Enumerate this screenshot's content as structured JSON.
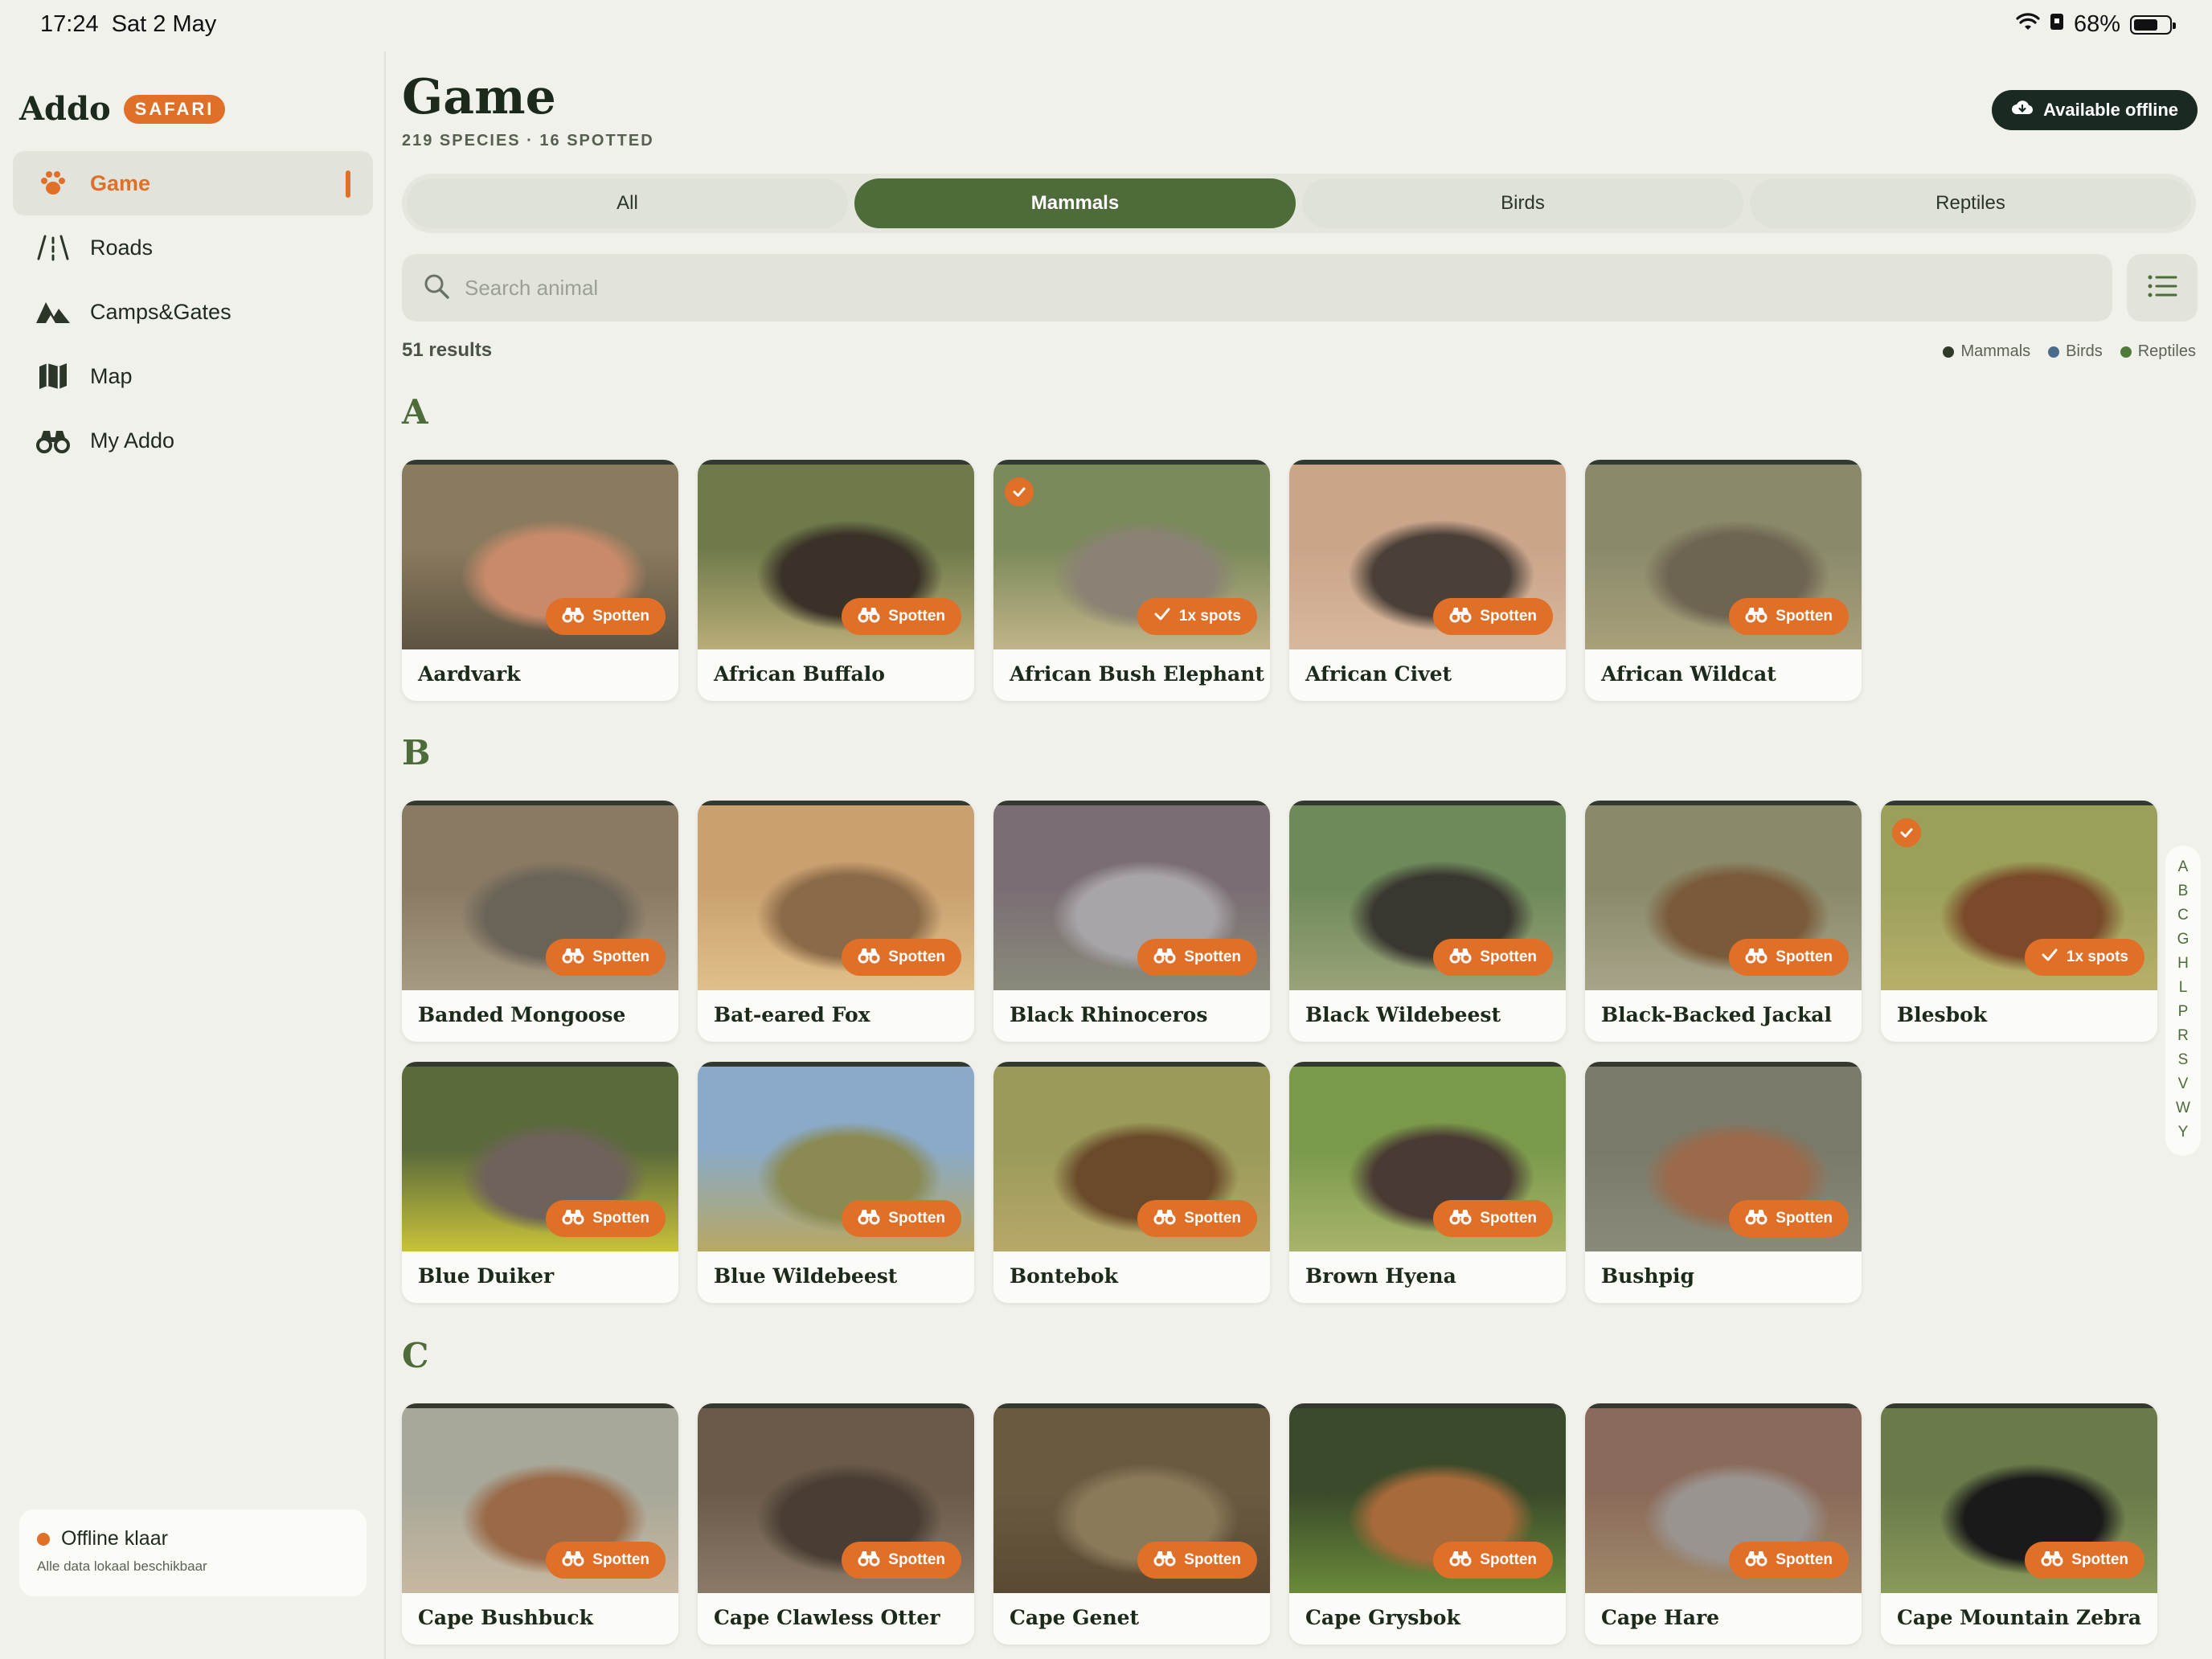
{
  "status": {
    "time": "17:24",
    "date": "Sat 2 May",
    "battery": "68%",
    "battery_level": 0.68
  },
  "sidebar": {
    "brand": "Addo",
    "badge": "SAFARI",
    "items": [
      {
        "label": "Game",
        "icon": "paw-icon",
        "active": true
      },
      {
        "label": "Roads",
        "icon": "road-icon",
        "active": false
      },
      {
        "label": "Camps&Gates",
        "icon": "mountains-icon",
        "active": false
      },
      {
        "label": "Map",
        "icon": "map-icon",
        "active": false
      },
      {
        "label": "My Addo",
        "icon": "binoculars-icon",
        "active": false
      }
    ],
    "offline": {
      "title": "Offline klaar",
      "subtitle": "Alle data lokaal beschikbaar"
    }
  },
  "header": {
    "title": "Game",
    "subtitle": "219 SPECIES · 16 SPOTTED",
    "offline_button": "Available offline"
  },
  "tabs": [
    {
      "label": "All",
      "active": false
    },
    {
      "label": "Mammals",
      "active": true
    },
    {
      "label": "Birds",
      "active": false
    },
    {
      "label": "Reptiles",
      "active": false
    }
  ],
  "search": {
    "placeholder": "Search animal",
    "value": ""
  },
  "results": "51 results",
  "legend": [
    {
      "label": "Mammals",
      "color": "#2f3a2b"
    },
    {
      "label": "Birds",
      "color": "#4b6b8a"
    },
    {
      "label": "Reptiles",
      "color": "#4e7a3a"
    }
  ],
  "sections": [
    {
      "letter": "A",
      "animals": [
        {
          "name": "Aardvark",
          "badge": "Spotten",
          "spotted": false,
          "colors": [
            "#8a7a5e",
            "#c88a6a",
            "#5e5442"
          ]
        },
        {
          "name": "African Buffalo",
          "badge": "Spotten",
          "spotted": false,
          "colors": [
            "#6e7a4a",
            "#3a3228",
            "#b9ad78"
          ]
        },
        {
          "name": "African Bush Elephant",
          "badge": "1x spots",
          "spotted": true,
          "colors": [
            "#7a8a5a",
            "#8a8274",
            "#c2b48a"
          ]
        },
        {
          "name": "African Civet",
          "badge": "Spotten",
          "spotted": false,
          "colors": [
            "#caa58a",
            "#4a4038",
            "#d8b89c"
          ]
        },
        {
          "name": "African Wildcat",
          "badge": "Spotten",
          "spotted": false,
          "colors": [
            "#8a8a6a",
            "#6e6452",
            "#a8a07a"
          ]
        }
      ]
    },
    {
      "letter": "B",
      "animals": [
        {
          "name": "Banded Mongoose",
          "badge": "Spotten",
          "spotted": false,
          "colors": [
            "#8a7a64",
            "#6a6458",
            "#a69a82"
          ]
        },
        {
          "name": "Bat-eared Fox",
          "badge": "Spotten",
          "spotted": false,
          "colors": [
            "#caa070",
            "#8a6a48",
            "#e0c08a"
          ]
        },
        {
          "name": "Black Rhinoceros",
          "badge": "Spotten",
          "spotted": false,
          "colors": [
            "#7a6e74",
            "#a8a4a8",
            "#8a8a7a"
          ]
        },
        {
          "name": "Black Wildebeest",
          "badge": "Spotten",
          "spotted": false,
          "colors": [
            "#6e8a5a",
            "#3a3630",
            "#9aa27a"
          ]
        },
        {
          "name": "Black-Backed Jackal",
          "badge": "Spotten",
          "spotted": false,
          "colors": [
            "#8a8a6a",
            "#7a5a3a",
            "#a8a48a"
          ]
        },
        {
          "name": "Blesbok",
          "badge": "1x spots",
          "spotted": true,
          "colors": [
            "#9aa05a",
            "#7a4a2a",
            "#b8b06a"
          ]
        },
        {
          "name": "Blue Duiker",
          "badge": "Spotten",
          "spotted": false,
          "colors": [
            "#5a6a3a",
            "#6e625a",
            "#c8c23a"
          ]
        },
        {
          "name": "Blue Wildebeest",
          "badge": "Spotten",
          "spotted": false,
          "colors": [
            "#8aaac8",
            "#8a8a52",
            "#b8a862"
          ]
        },
        {
          "name": "Bontebok",
          "badge": "Spotten",
          "spotted": false,
          "colors": [
            "#9a9a5a",
            "#6a4a2a",
            "#b8a86a"
          ]
        },
        {
          "name": "Brown Hyena",
          "badge": "Spotten",
          "spotted": false,
          "colors": [
            "#7a9a4a",
            "#4a3a34",
            "#a8b46a"
          ]
        },
        {
          "name": "Bushpig",
          "badge": "Spotten",
          "spotted": false,
          "colors": [
            "#7a7a6a",
            "#9a6a4a",
            "#8a8a7a"
          ]
        }
      ]
    },
    {
      "letter": "C",
      "animals": [
        {
          "name": "Cape Bushbuck",
          "badge": "Spotten",
          "spotted": false,
          "colors": [
            "#a8a89a",
            "#9a6a48",
            "#c8b8a0"
          ]
        },
        {
          "name": "Cape Clawless Otter",
          "badge": "Spotten",
          "spotted": false,
          "colors": [
            "#6a5a4a",
            "#4a3e34",
            "#8a7a68"
          ]
        },
        {
          "name": "Cape Genet",
          "badge": "Spotten",
          "spotted": false,
          "colors": [
            "#6a5a40",
            "#8a7a5a",
            "#5a4a34"
          ]
        },
        {
          "name": "Cape Grysbok",
          "badge": "Spotten",
          "spotted": false,
          "colors": [
            "#3a4a2a",
            "#a86a3a",
            "#6a8a3a"
          ]
        },
        {
          "name": "Cape Hare",
          "badge": "Spotten",
          "spotted": false,
          "colors": [
            "#8a6a5a",
            "#9a9490",
            "#a08a6a"
          ]
        },
        {
          "name": "Cape Mountain Zebra",
          "badge": "Spotten",
          "spotted": false,
          "colors": [
            "#6a7a4a",
            "#1a1a1a",
            "#8a9a5a"
          ]
        }
      ]
    }
  ],
  "index_letters": [
    "A",
    "B",
    "C",
    "G",
    "H",
    "L",
    "P",
    "R",
    "S",
    "V",
    "W",
    "Y"
  ]
}
